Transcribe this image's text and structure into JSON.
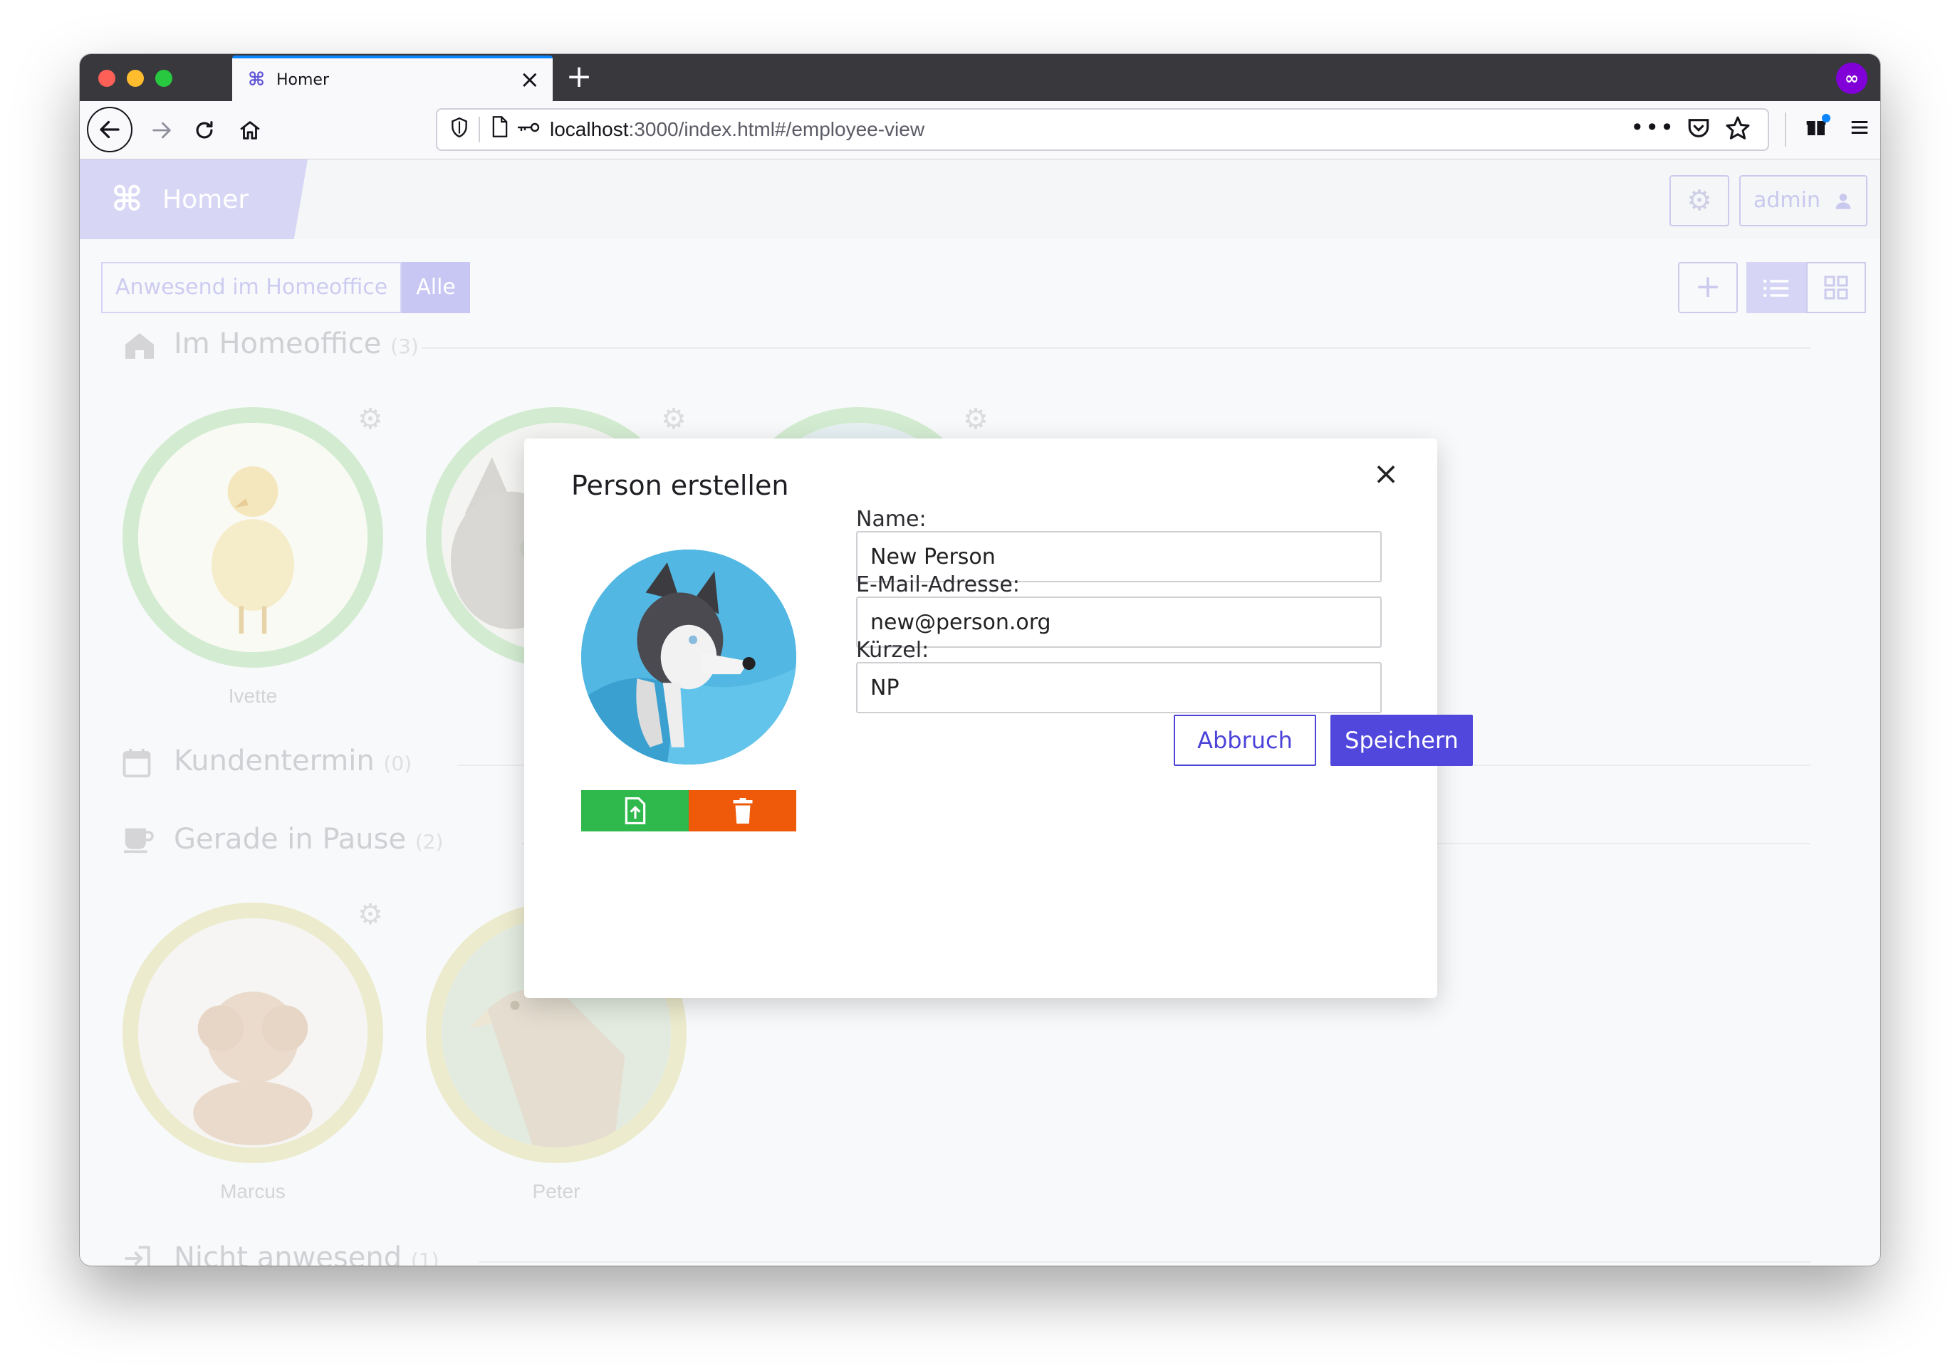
{
  "browser": {
    "tab_title": "Homer",
    "tab_close": "×",
    "new_tab": "+",
    "url_host": "localhost",
    "url_rest": ":3000/index.html#/employee-view",
    "private_icon": "∞"
  },
  "header": {
    "brand_name": "Homer",
    "brand_logo": "⌘",
    "admin_label": "admin"
  },
  "filters": {
    "homeoffice_label": "Anwesend im Homeoffice",
    "all_label": "Alle",
    "active": "Alle"
  },
  "sections": [
    {
      "title": "Im Homeoffice",
      "count": "(3)",
      "icon": "home-icon"
    },
    {
      "title": "Kundentermin",
      "count": "(0)",
      "icon": "calendar-icon"
    },
    {
      "title": "Gerade in Pause",
      "count": "(2)",
      "icon": "coffee-icon"
    },
    {
      "title": "Nicht anwesend",
      "count": "(1)",
      "icon": "signin-icon"
    }
  ],
  "employees": {
    "homeoffice": [
      {
        "name": "Ivette",
        "status_color": "#d3ecd1"
      },
      {
        "name": "",
        "status_color": "#d3ecd1"
      },
      {
        "name": "",
        "status_color": "#d3ecd1"
      }
    ],
    "pause": [
      {
        "name": "Marcus",
        "status_color": "#ecebcd"
      },
      {
        "name": "Peter",
        "status_color": "#ecebcd"
      }
    ]
  },
  "modal": {
    "title": "Person erstellen",
    "close": "×",
    "name_label": "Name:",
    "name_value": "New Person",
    "email_label": "E-Mail-Adresse:",
    "email_value": "new@person.org",
    "short_label": "Kürzel:",
    "short_value": "NP",
    "cancel_label": "Abbruch",
    "save_label": "Speichern"
  },
  "colors": {
    "primary": "#5147dc",
    "upload": "#2fb84b",
    "delete": "#ee5a0a"
  }
}
